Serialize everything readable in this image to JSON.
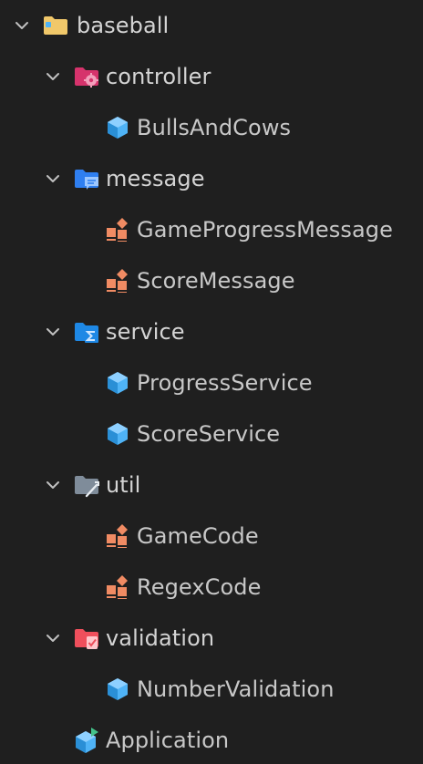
{
  "tree": {
    "root": {
      "label": "baseball",
      "expanded": true,
      "icon": "folder-icon",
      "icon_color": "#f1c86a"
    },
    "folders": [
      {
        "label": "controller",
        "expanded": true,
        "icon": "folder-gear-icon",
        "icon_color": "#d6336c",
        "children": [
          {
            "label": "BullsAndCows",
            "icon": "class-cube-icon"
          }
        ]
      },
      {
        "label": "message",
        "expanded": true,
        "icon": "folder-message-icon",
        "icon_color": "#2f7ff0",
        "children": [
          {
            "label": "GameProgressMessage",
            "icon": "enum-icon"
          },
          {
            "label": "ScoreMessage",
            "icon": "enum-icon"
          }
        ]
      },
      {
        "label": "service",
        "expanded": true,
        "icon": "folder-sigma-icon",
        "icon_color": "#1e88e5",
        "children": [
          {
            "label": "ProgressService",
            "icon": "class-cube-icon"
          },
          {
            "label": "ScoreService",
            "icon": "class-cube-icon"
          }
        ]
      },
      {
        "label": "util",
        "expanded": true,
        "icon": "folder-tools-icon",
        "icon_color": "#7f8c9a",
        "children": [
          {
            "label": "GameCode",
            "icon": "enum-icon"
          },
          {
            "label": "RegexCode",
            "icon": "enum-icon"
          }
        ]
      },
      {
        "label": "validation",
        "expanded": true,
        "icon": "folder-check-icon",
        "icon_color": "#ef4f5c",
        "children": [
          {
            "label": "NumberValidation",
            "icon": "class-cube-icon"
          }
        ]
      }
    ],
    "files": [
      {
        "label": "Application",
        "icon": "application-cube-icon"
      }
    ]
  },
  "colors": {
    "background": "#1f1f1f",
    "text": "#d4d4d4",
    "chevron": "#c0c0c0",
    "class_cube": "#4fb3f6",
    "enum": "#f08b63"
  }
}
